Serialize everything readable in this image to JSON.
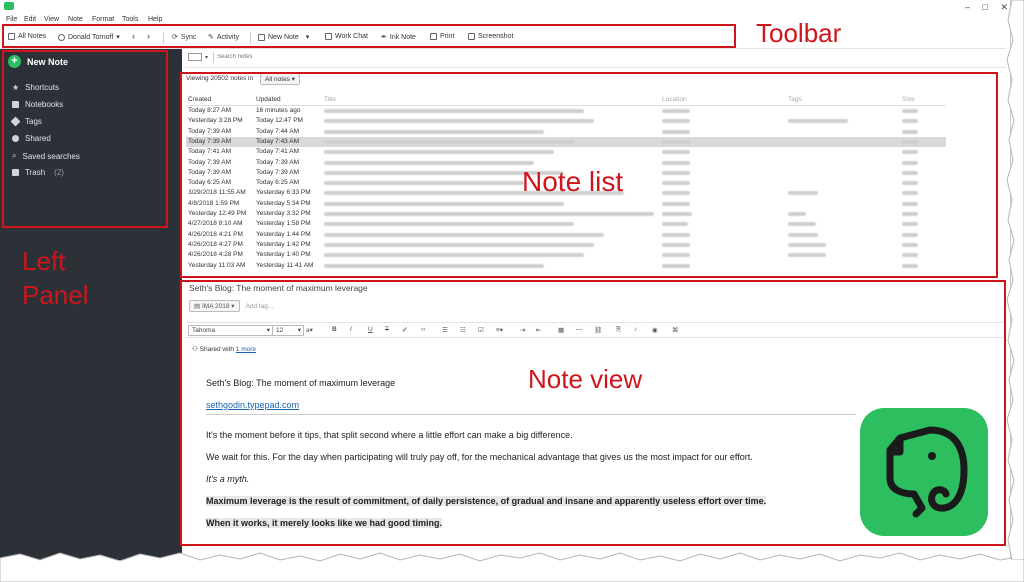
{
  "menu": [
    "File",
    "Edit",
    "View",
    "Note",
    "Format",
    "Tools",
    "Help"
  ],
  "toolbar": {
    "all_notes": "All Notes",
    "user": "Donald Tornoff",
    "sync": "Sync",
    "activity": "Activity",
    "new_note": "New Note",
    "work_chat": "Work Chat",
    "ink_note": "Ink Note",
    "print": "Print",
    "screenshot": "Screenshot"
  },
  "search": {
    "placeholder": "Search notes"
  },
  "left_panel": {
    "new_note": "New Note",
    "items": [
      {
        "label": "Shortcuts",
        "icon": "star-icon"
      },
      {
        "label": "Notebooks",
        "icon": "notebook-icon"
      },
      {
        "label": "Tags",
        "icon": "tag-icon"
      },
      {
        "label": "Shared",
        "icon": "people-icon"
      },
      {
        "label": "Saved searches",
        "icon": "search-icon"
      },
      {
        "label": "Trash",
        "icon": "trash-icon",
        "count": "(2)"
      }
    ]
  },
  "note_list": {
    "viewing": "Viewing 20502 notes in",
    "scope": "All notes",
    "columns": [
      "Created",
      "Updated",
      "Title",
      "Location",
      "Tags",
      "Size"
    ],
    "rows": [
      {
        "created": "Today 8:27 AM",
        "updated": "16 minutes ago"
      },
      {
        "created": "Yesterday 3:28 PM",
        "updated": "Today 12:47 PM"
      },
      {
        "created": "Today 7:39 AM",
        "updated": "Today 7:44 AM"
      },
      {
        "created": "Today 7:39 AM",
        "updated": "Today 7:43 AM"
      },
      {
        "created": "Today 7:41 AM",
        "updated": "Today 7:41 AM"
      },
      {
        "created": "Today 7:39 AM",
        "updated": "Today 7:39 AM"
      },
      {
        "created": "Today 7:39 AM",
        "updated": "Today 7:39 AM"
      },
      {
        "created": "Today 6:25 AM",
        "updated": "Today 6:25 AM"
      },
      {
        "created": "3/29/2018 11:55 AM",
        "updated": "Yesterday 6:33 PM"
      },
      {
        "created": "4/8/2018 1:59 PM",
        "updated": "Yesterday 5:34 PM"
      },
      {
        "created": "Yesterday 12:49 PM",
        "updated": "Yesterday 3:32 PM"
      },
      {
        "created": "4/27/2018 8:10 AM",
        "updated": "Yesterday 1:58 PM"
      },
      {
        "created": "4/26/2018 4:21 PM",
        "updated": "Yesterday 1:44 PM"
      },
      {
        "created": "4/26/2018 4:27 PM",
        "updated": "Yesterday 1:42 PM"
      },
      {
        "created": "4/26/2018 4:28 PM",
        "updated": "Yesterday 1:40 PM"
      },
      {
        "created": "Yesterday 11:03 AM",
        "updated": "Yesterday 11:41 AM"
      }
    ]
  },
  "note_view": {
    "title": "Seth's Blog: The moment of maximum leverage",
    "notebook": "IMA 2018",
    "add_tag": "Add tag...",
    "font": "Tahoma",
    "font_size": "12",
    "shared_with": "Shared with",
    "shared_more": "1 more",
    "body_title": "Seth's Blog: The moment of maximum leverage",
    "link": "sethgodin.typepad.com",
    "para1": "It's the moment before it tips, that split second where a little effort can make a big difference.",
    "para2": "We wait for this. For the day when participating will truly pay off, for the mechanical advantage that gives us the most impact for our effort.",
    "para3": "It's a myth.",
    "para4": "Maximum leverage is the result of commitment, of daily persistence, of gradual and insane and apparently useless effort over time.",
    "para5": "When it works, it merely looks like we had good timing."
  },
  "annotations": {
    "toolbar": "Toolbar",
    "left_panel_1": "Left",
    "left_panel_2": "Panel",
    "note_list": "Note list",
    "note_view": "Note view",
    "color": "#d0141c"
  },
  "colors": {
    "sidebar": "#2b3137",
    "accent": "#2dbe60"
  }
}
